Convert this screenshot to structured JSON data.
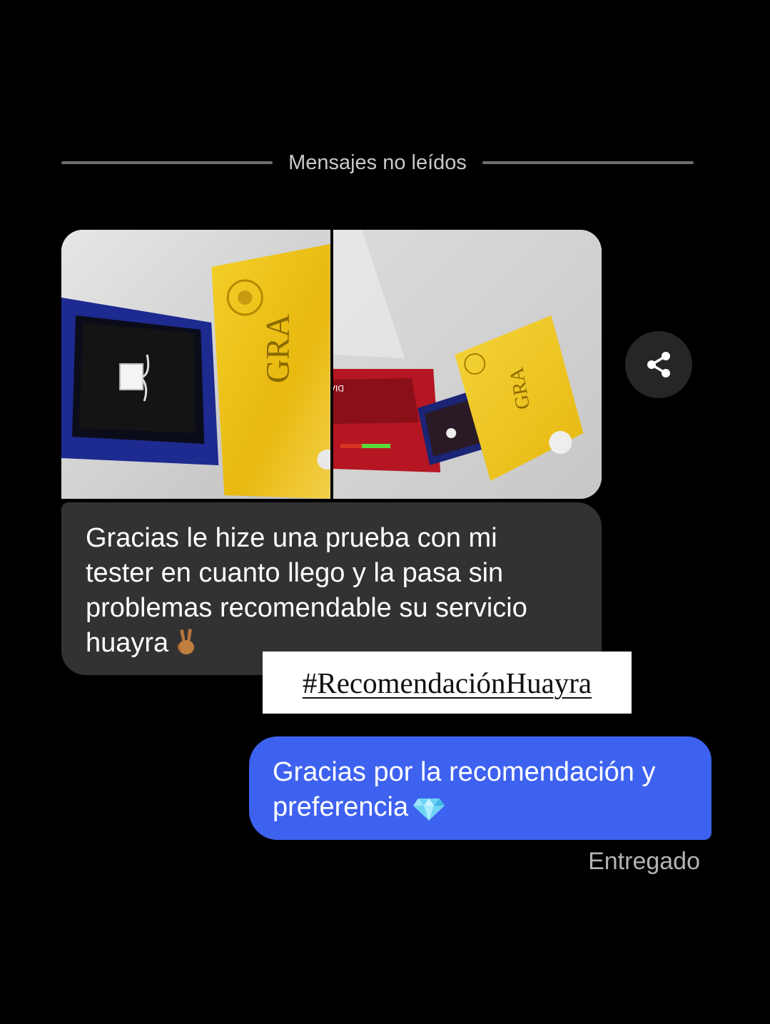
{
  "divider": {
    "label": "Mensajes no leídos"
  },
  "images": [
    {
      "icon": "ring-box-with-gold-certificate"
    },
    {
      "icon": "ring-box-with-diamond-tester-and-certificate"
    }
  ],
  "share": {
    "icon": "share-icon"
  },
  "incoming": {
    "lines": [
      "Gracias le hize una prueba con mi",
      "tester en cuanto llego y la pasa sin",
      "problemas recomendable su servicio",
      "huayra"
    ],
    "emoji": "victory-hand-icon"
  },
  "overlay": {
    "hashtag": "#RecomendaciónHuayra"
  },
  "outgoing": {
    "lines": [
      "Gracias por la recomendación y",
      "preferencia"
    ],
    "emoji": "gem-icon"
  },
  "status": "Entregado",
  "colors": {
    "background": "#000000",
    "incoming_bubble": "#323232",
    "outgoing_bubble": "#3e62f0",
    "divider_line": "#6f6f6f"
  }
}
